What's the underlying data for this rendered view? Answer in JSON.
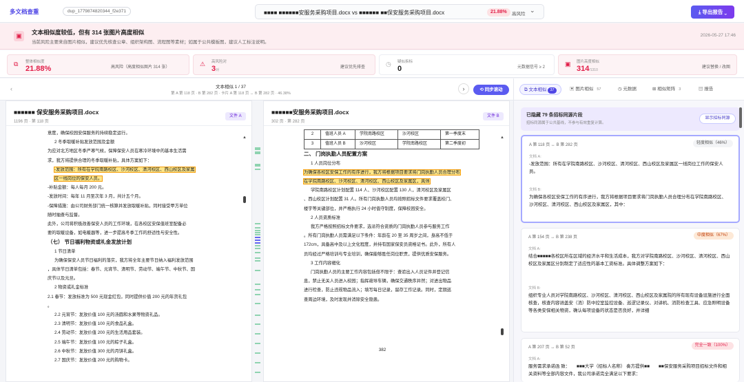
{
  "app": {
    "brand": "多文档查重",
    "doc_id": "dup_1779874820344_f2e371"
  },
  "compare": {
    "title": "■■■■ ■■■■■■安服务采购项目.docx vs ■■■■■■ ■■保安服务采购项目.docx",
    "rate": "21.88%",
    "risk": "高风险",
    "export_label": "导出报告"
  },
  "alert": {
    "title": "文本相似度较低，但有 314 张图片高度相似",
    "desc": "当前风险主要来自图片相似，建议优先核查公章、组织架构图、流程图等素材；如属于公共模板图，建议人工标注说明。",
    "date": "2026-05-27 17:46"
  },
  "stats": [
    {
      "label": "整体相似度",
      "value": "21.88%",
      "note": "高风险（高度相似图片 314 张）"
    },
    {
      "label": "高风险对",
      "value": "3",
      "sub": "对",
      "note": "建议优先排查"
    },
    {
      "label": "疑似拆标",
      "value": "0",
      "note": "元数据信号 ≥ 2"
    },
    {
      "label": "图片高度相似",
      "value": "314",
      "sub": "/1310",
      "note": "建议替换 / 改图"
    }
  ],
  "nav": {
    "counter": "文本相似 1 / 37",
    "sub": "第 A 第 118 页 · B 第 282 页 · 卡片 A 第 118 页 ↔ B 第 282 页 · 46.38%",
    "sync_label": "同步滚动"
  },
  "docA": {
    "name": "■■■■■■ 保安服务采购项目.docx",
    "meta": "1196 页 · 第 118 页",
    "tag": "文件 A",
    "lines": [
      "意度，确保校园安保服务的持续稳定运行。",
      "2 冬季取暖补贴发放范围及金额",
      "为应对北方地区冬季严寒气候，保障保安人员在寒冷环境中的基本生活需",
      "求，我方将提供合理的冬季取暖补贴，具体方案如下：",
      "-发放范围：所有在学院南路校区、沙河校区、清河校区、西山校区及家属",
      "区一线岗位的保安人员。",
      "-补贴金额：每人每月 200 元。",
      "-发放时间：每年 11 月至次年 3 月，共计五个月。",
      "-保障措施：由公司财务部门统一核算并发放取暖补贴，同时接受甲方单位",
      "随时抽查与监督。",
      "此外，公司将积极改善保安人员的工作环境，在各校区安保值班室配备必",
      "要的取暖设备，如电暖器等，进一步提高冬季工作的舒适性与安全性。",
      "（七） 节日福利物资或礼金发放计划",
      "1 节日清单",
      "为确保保安人员节日福利的落实，我方将全年主要节日纳入福利发放范围",
      "，具体节日清单包括：春节、元宵节、清明节、劳动节、端午节、中秋节、国",
      "庆节以及元旦。",
      "2 物资或礼金标准",
      "2.1 春节：发放标准为 500 元现金红包，同时提供价值 200 元的年货礼包",
      "。",
      "2.2 元宵节：发放价值 100 元的汤圆和水果等物资礼品。",
      "2.3 清明节：发放价值 100 元的食品礼盒。",
      "2.4 劳动节：发放价值 200 元的生活用品套装。",
      "2.5 端午节：发放价值 100 元的粽子礼盒。",
      "2.6 中秋节：发放价值 300 元的月饼礼盒。",
      "2.7 国庆节：发放价值 200 元的购物卡。"
    ]
  },
  "docB": {
    "name": "■■■■■■安服务采购项目.docx",
    "meta": "302 页 · 第 282 页",
    "tag": "文件 B",
    "table": [
      [
        "2",
        "值班人员 A",
        "学院南路校区",
        "沙河校区",
        "第一季度末"
      ],
      [
        "3",
        "值班人员 B",
        "沙河校区",
        "学院南路校区",
        "第二季度初"
      ]
    ],
    "section": "二、 门岗执勤人员配置方案",
    "lines": [
      "1 人员岗位分布",
      "为确保各校区安保工作的有序进行，我方将根据项目要求将门岗执勤人员合理分布",
      "在学院南路校区、沙河校区、清河校区、西山校区及家属区，具体",
      "学院南路校区计划配置 114 人、沙河校区配置 130 人，清河校区及家属区",
      "、西山校区计划配置 31 人。所有门岗执勤人员均按照招标文件要求覆盖校门、",
      "楼宇等关键部位，并严格执行 24 小时值守制度，保障校园安全。",
      "2 人员资质标准",
      "我方严格按照招标文件要求，选派符合资质的门岗执勤人员参与服务工作",
      "。所有门岗执勤人员需满足以下条件：年龄在 20 至 35 周岁之间，身高不低于",
      "172cm，具备高中及以上文化程度，并持有国家保安员资格证书。此外，所有人",
      "员均经过严格培训与专业培训，确保能够胜任岗位职责，提供优质安保服务。",
      "3 工作内容细化",
      "门岗执勤人员的主要工作内容包括但不限于：查验出入人员证件并登记信",
      "息，禁止无关人员进入校园；指挥疏导车辆，确保交通秩序井然；对进出物品",
      "进行检查，防止违规物品流入；填写每日记录，留存工作记录。同时，定期巡",
      "查周边环境，及时发现并消除安全隐患。"
    ],
    "page_number": "382"
  },
  "tabs": [
    {
      "label": "文本相似",
      "count": "37"
    },
    {
      "label": "图片相似",
      "count": "57"
    },
    {
      "label": "元数据",
      "count": ""
    },
    {
      "label": "相似矩阵",
      "count": "3"
    },
    {
      "label": "报告",
      "count": ""
    }
  ],
  "hidden": {
    "title": "已隐藏 79 条招标同源片段",
    "desc": "招标同源属于公共基线，不参与有效重复计算。",
    "button": "显示招标同源"
  },
  "cards": [
    {
      "header": "A 第 118 页 ↔ B 第 282 页",
      "level": "轻度相似（46%）",
      "a_label": "文档 A:",
      "a_text": "-发放范围：所有在学院南路校区、沙河校区、清河校区、西山校区及家属区一线岗位工作的保安人员。",
      "b_label": "文档 B:",
      "b_text": "为确保各校区安保工作的有序进行，我方将根据项目要求将门岗执勤人员合理分布在学院南路校区、沙河校区、清河校区、西山校区及家属区，其中："
    },
    {
      "header": "A 第 154 页 ↔ B 第 238 页",
      "level": "中度相似（67%）",
      "a_label": "文档 A:",
      "a_text": "结合■■■■■各校区所在区域的经济水平和生活成本，我方对学院南路校区、沙河校区、清河校区、西山校区及家属区分别制定了适应性的基本工资标准。具体调整方案如下：",
      "b_label": "文档 B:",
      "b_text": "组织专业人员对学院南路校区、沙河校区、清河校区、西山校区及家属院的所有现有设备设施进行全面核查，核查内容涵盖安（消）防中控室监控设备、巡逻记录仪、对讲机、消防检查工具、应急照明设备等各类安保相关物资，确认每项设备的状态是否良好，并详细"
    },
    {
      "header": "A 第 207 页 ↔ B 第 52 页",
      "level": "完全一致（100%）",
      "a_label": "文档 A:",
      "a_text": "服务需求承诺函 致：　　■■■大学（招标人名称） 奏方提供■■　　■■保安服务采购项目招标文件和相关资料等全部内容文件，我公司承诺完全满足以下要求："
    }
  ],
  "colors": {
    "accent": "#5b5bf0",
    "danger": "#e11d48",
    "highlight": "#fde68a"
  }
}
